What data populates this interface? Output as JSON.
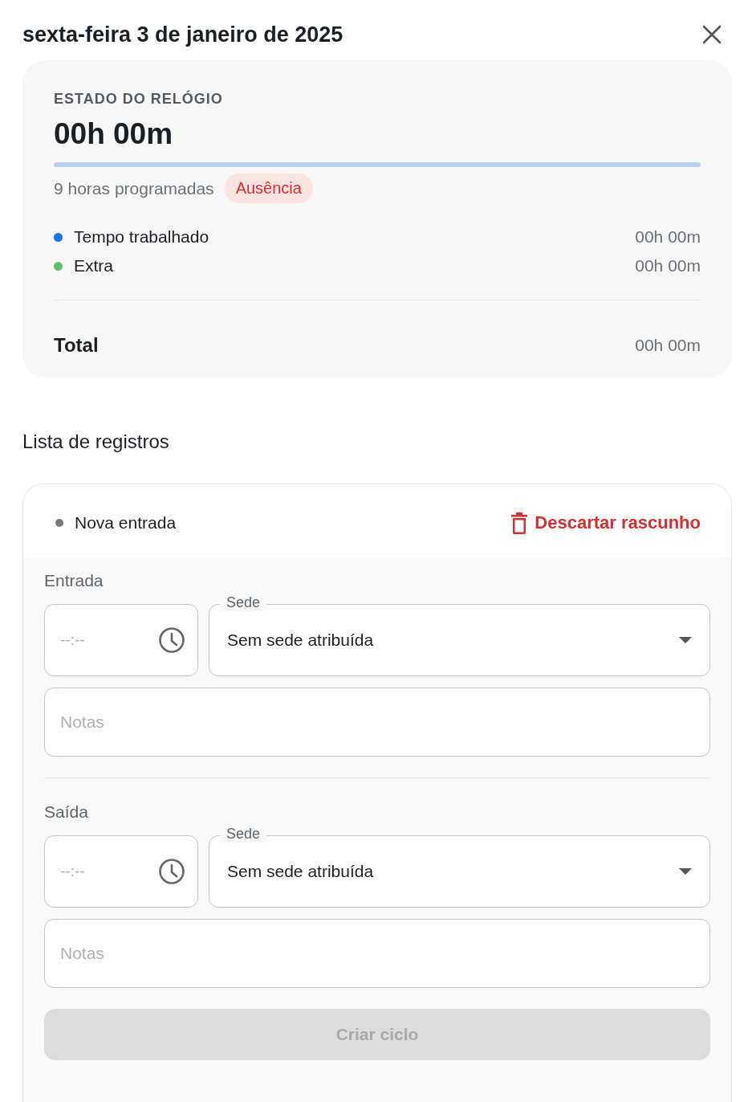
{
  "dialog": {
    "title": "sexta-feira 3 de janeiro de 2025"
  },
  "clock_status": {
    "label": "ESTADO DO RELÓGIO",
    "time": "00h 00m",
    "scheduled": "9 horas programadas",
    "badge": "Ausência",
    "rows": [
      {
        "label": "Tempo trabalhado",
        "value": "00h 00m",
        "color": "#1a73e8"
      },
      {
        "label": "Extra",
        "value": "00h 00m",
        "color": "#5cc16a"
      }
    ],
    "total": {
      "label": "Total",
      "value": "00h 00m"
    }
  },
  "records": {
    "title": "Lista de registros",
    "draft": {
      "label": "Nova entrada",
      "discard": "Descartar rascunho"
    },
    "sections": [
      {
        "title": "Entrada",
        "time": {
          "placeholder": "--:--"
        },
        "site": {
          "label": "Sede",
          "value": "Sem sede atribuída"
        },
        "notes": {
          "placeholder": "Notas"
        }
      },
      {
        "title": "Saída",
        "time": {
          "placeholder": "--:--"
        },
        "site": {
          "label": "Sede",
          "value": "Sem sede atribuída"
        },
        "notes": {
          "placeholder": "Notas"
        }
      }
    ],
    "submit": {
      "label": "Criar ciclo",
      "disabled": true
    }
  }
}
